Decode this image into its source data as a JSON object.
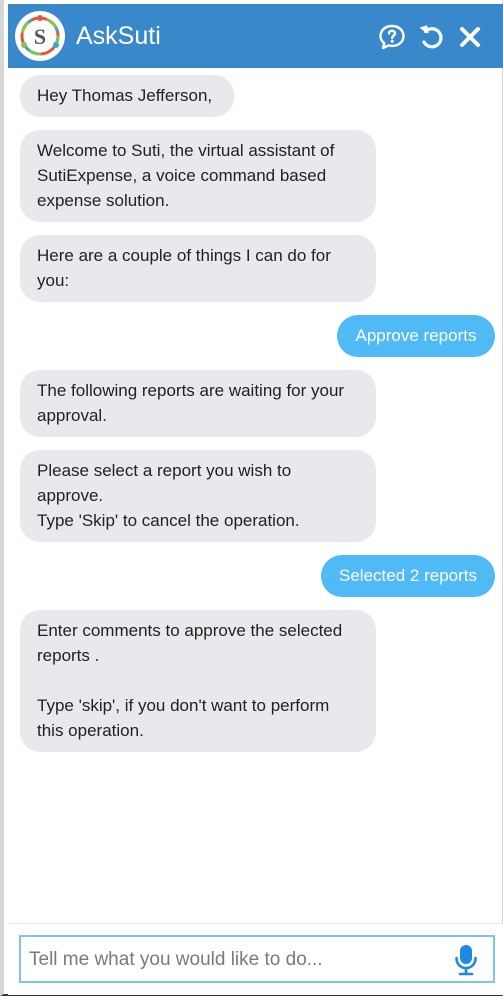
{
  "header": {
    "title": "AskSuti",
    "logo_letter": "S",
    "icons": [
      "help-icon",
      "reset-icon",
      "close-icon"
    ],
    "color": "#3a88cc"
  },
  "messages": [
    {
      "from": "bot",
      "text": "Hey Thomas Jefferson,"
    },
    {
      "from": "bot",
      "text": "Welcome to Suti, the virtual assistant of\nSutiExpense, a voice command based\nexpense solution."
    },
    {
      "from": "bot",
      "text": "Here are a couple of things I can do for\nyou:"
    },
    {
      "from": "user",
      "text": "Approve reports"
    },
    {
      "from": "bot",
      "text": "The following reports are waiting for your\napproval."
    },
    {
      "from": "bot",
      "text": "Please select a report you wish to\napprove.\nType 'Skip' to cancel the operation."
    },
    {
      "from": "user",
      "text": "Selected 2 reports"
    },
    {
      "from": "bot",
      "text": "Enter comments to approve the selected\nreports .\n\nType 'skip', if you don't want to perform\nthis operation."
    }
  ],
  "composer": {
    "placeholder": "Tell me what you would like to do...",
    "value": "",
    "mic_icon": "microphone-icon"
  },
  "colors": {
    "bot_bubble": "#e8e9ec",
    "user_bubble": "#4fbaf5",
    "input_border": "#7fc4ee"
  }
}
